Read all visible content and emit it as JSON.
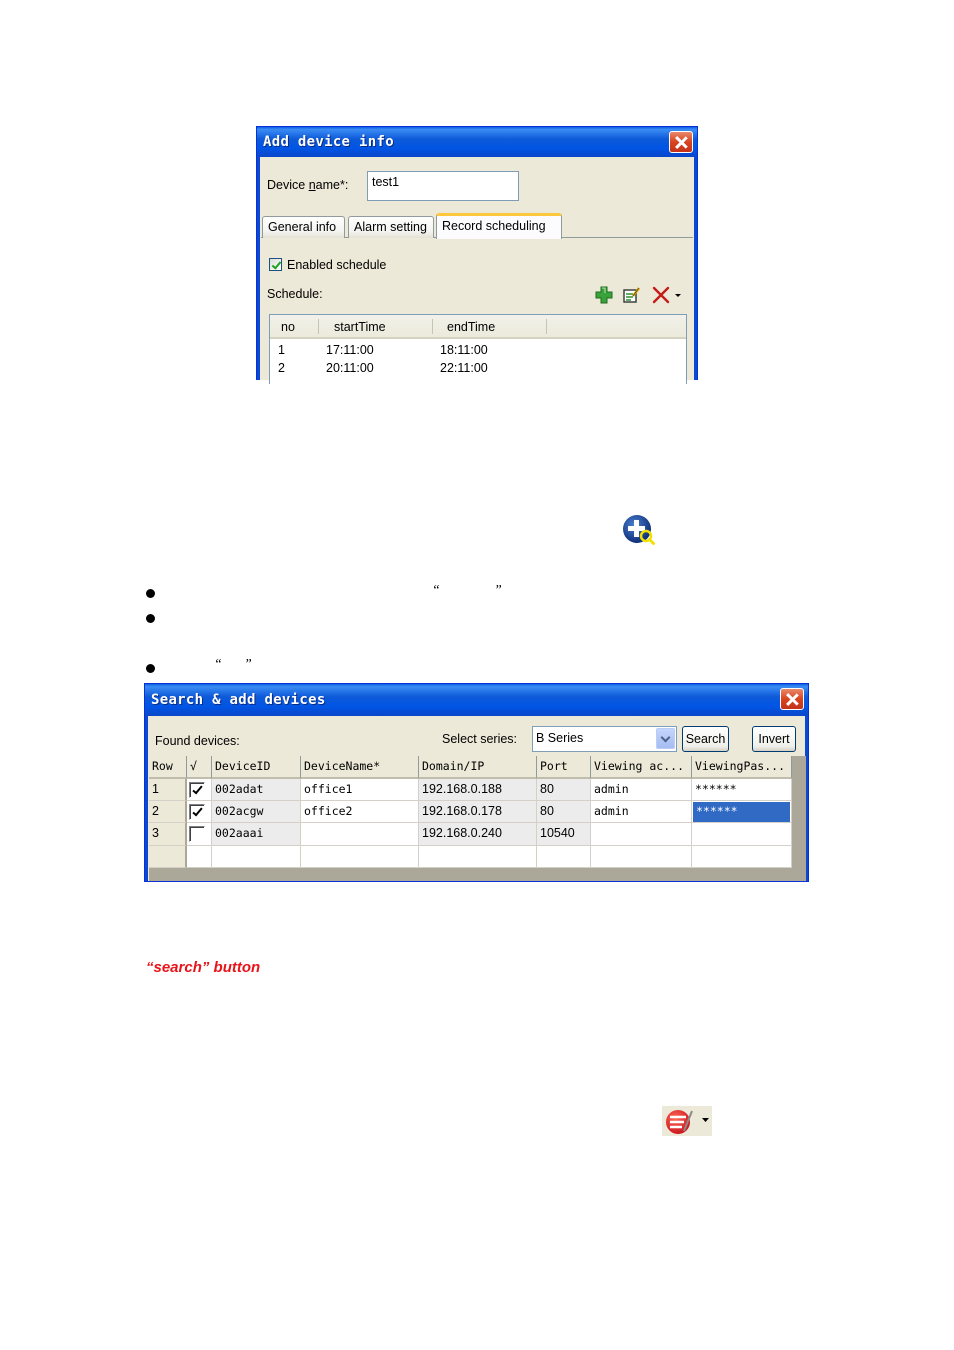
{
  "add_device_dialog": {
    "title": "Add device info",
    "device_name_label_pre": "Device ",
    "device_name_label_u": "n",
    "device_name_label_post": "ame*:",
    "device_name_value": "test1",
    "tabs": [
      {
        "label": "General info",
        "active": false
      },
      {
        "label": "Alarm setting",
        "active": false
      },
      {
        "label": "Record scheduling",
        "active": true
      }
    ],
    "enabled_schedule_label": "Enabled schedule",
    "enabled_schedule_checked": true,
    "schedule_label": "Schedule:",
    "toolbar_icons": [
      "add-icon",
      "edit-icon",
      "delete-icon",
      "dropdown-arrow-icon"
    ],
    "schedule_grid": {
      "columns": [
        "no",
        "startTime",
        "endTime"
      ],
      "rows": [
        [
          "1",
          "17:11:00",
          "18:11:00"
        ],
        [
          "2",
          "20:11:00",
          "22:11:00"
        ]
      ]
    }
  },
  "search_add_icon": "search-add-device-icon",
  "bullets": [
    {
      "quote_open": "“",
      "quote_close": "”"
    },
    {},
    {
      "quote_open": "“",
      "quote_close": "”"
    }
  ],
  "search_dialog": {
    "title": "Search & add devices",
    "found_devices_label": "Found devices:",
    "select_series_label": "Select series:",
    "series_value": "B Series",
    "search_button": "Search",
    "invert_button": "Invert",
    "grid": {
      "columns": [
        "Row",
        "√",
        "DeviceID",
        "DeviceName*",
        "Domain/IP",
        "Port",
        "Viewing ac...",
        "ViewingPas..."
      ],
      "rows": [
        {
          "row": "1",
          "checked": true,
          "device_id": "002adat",
          "device_name": "office1",
          "ip": "192.168.0.188",
          "port": "80",
          "account": "admin",
          "password": "******"
        },
        {
          "row": "2",
          "checked": true,
          "device_id": "002acgw",
          "device_name": "office2",
          "ip": "192.168.0.178",
          "port": "80",
          "account": "admin",
          "password": "******",
          "password_selected": true
        },
        {
          "row": "3",
          "checked": false,
          "device_id": "002aaai",
          "device_name": "",
          "ip": "192.168.0.240",
          "port": "10540",
          "account": "",
          "password": ""
        }
      ]
    }
  },
  "note": {
    "text": "“search”  button",
    "color": "#e8141a"
  },
  "record_icon": "record-menu-icon"
}
